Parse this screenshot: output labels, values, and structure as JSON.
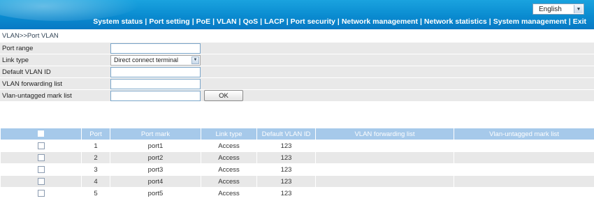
{
  "header": {
    "language": "English",
    "nav": [
      "System status",
      "Port setting",
      "PoE",
      "VLAN",
      "QoS",
      "LACP",
      "Port security",
      "Network management",
      "Network statistics",
      "System management",
      "Exit"
    ]
  },
  "breadcrumb": "VLAN>>Port VLAN",
  "form": {
    "port_range_label": "Port range",
    "port_range_value": "",
    "link_type_label": "Link type",
    "link_type_value": "Direct connect terminal",
    "default_vlan_label": "Default VLAN ID",
    "default_vlan_value": "",
    "forwarding_label": "VLAN forwarding list",
    "forwarding_value": "",
    "untagged_label": "Vlan-untagged mark list",
    "untagged_value": "",
    "ok_label": "OK"
  },
  "table": {
    "headers": [
      "",
      "Port",
      "Port mark",
      "Link type",
      "Default VLAN ID",
      "VLAN forwarding list",
      "Vlan-untagged mark list"
    ],
    "rows": [
      {
        "port": "1",
        "mark": "port1",
        "link": "Access",
        "vlan": "123",
        "forward": "",
        "untagged": ""
      },
      {
        "port": "2",
        "mark": "port2",
        "link": "Access",
        "vlan": "123",
        "forward": "",
        "untagged": ""
      },
      {
        "port": "3",
        "mark": "port3",
        "link": "Access",
        "vlan": "123",
        "forward": "",
        "untagged": ""
      },
      {
        "port": "4",
        "mark": "port4",
        "link": "Access",
        "vlan": "123",
        "forward": "",
        "untagged": ""
      },
      {
        "port": "5",
        "mark": "port5",
        "link": "Access",
        "vlan": "123",
        "forward": "",
        "untagged": ""
      }
    ]
  },
  "colors": {
    "header_blue": "#0a8bd0",
    "table_header": "#a6c9ea",
    "row_stripe": "#e8e8e8",
    "form_row": "#e9e9e9"
  },
  "icons": [
    "dropdown-arrow-icon",
    "checkbox-icon"
  ]
}
